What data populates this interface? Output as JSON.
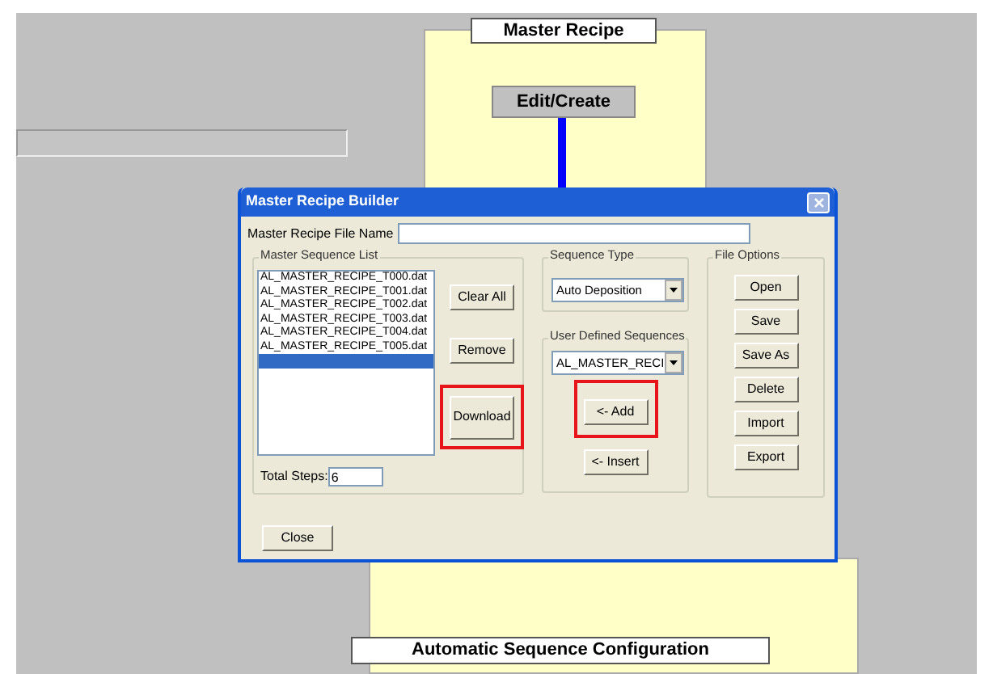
{
  "diagram": {
    "top_panel": {
      "title": "Master Recipe",
      "button": "Edit/Create"
    },
    "bottom_panel": {
      "title": "Automatic Sequence Configuration"
    }
  },
  "dialog": {
    "title": "Master Recipe Builder",
    "file_name": {
      "label": "Master Recipe File Name"
    },
    "sequence_list": {
      "title": "Master Sequence List",
      "items": [
        {
          "label": "AL_MASTER_RECIPE_T000.dat",
          "selected": false
        },
        {
          "label": "AL_MASTER_RECIPE_T001.dat",
          "selected": false
        },
        {
          "label": "AL_MASTER_RECIPE_T002.dat",
          "selected": false
        },
        {
          "label": "AL_MASTER_RECIPE_T003.dat",
          "selected": false
        },
        {
          "label": "AL_MASTER_RECIPE_T004.dat",
          "selected": false
        },
        {
          "label": "AL_MASTER_RECIPE_T005.dat",
          "selected": false
        },
        {
          "selected": true
        }
      ],
      "buttons": [
        {
          "label": "Clear All",
          "highlighted": false
        },
        {
          "label": "Remove",
          "highlighted": false
        },
        {
          "label": "Download",
          "highlighted": true
        }
      ],
      "total_steps": {
        "label": "Total Steps:",
        "value": "6"
      }
    },
    "sequence_type": {
      "title": "Sequence Type",
      "value": "Auto Deposition"
    },
    "user_sequences": {
      "title": "User Defined Sequences",
      "value": "AL_MASTER_RECI",
      "buttons": [
        {
          "label": "<- Add",
          "highlighted": true
        },
        {
          "label": "<- Insert",
          "highlighted": false
        }
      ]
    },
    "file_options": {
      "title": "File Options",
      "buttons": [
        {
          "label": "Open"
        },
        {
          "label": "Save"
        },
        {
          "label": "Save As"
        },
        {
          "label": "Delete"
        },
        {
          "label": "Import"
        },
        {
          "label": "Export"
        }
      ]
    },
    "close_button": "Close"
  }
}
